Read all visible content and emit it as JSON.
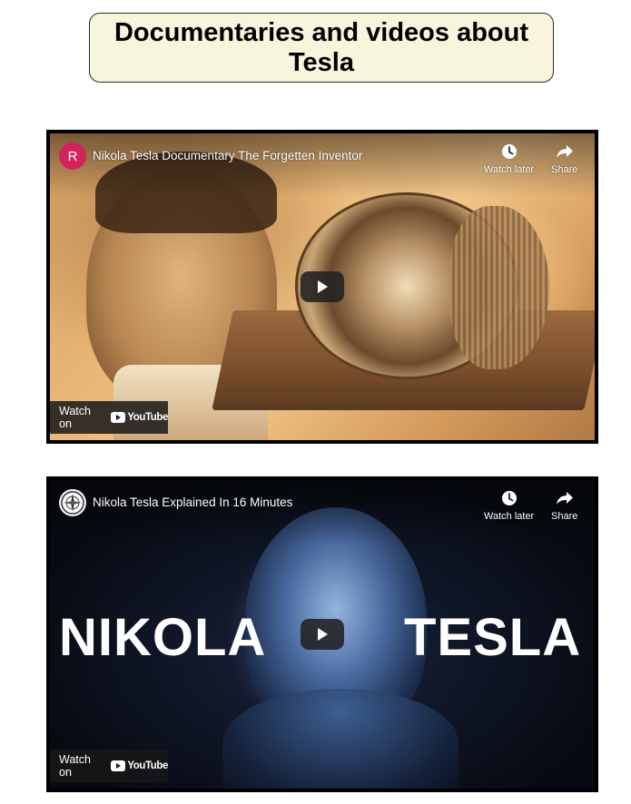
{
  "page": {
    "heading": "Documentaries and videos about Tesla"
  },
  "videos": [
    {
      "channel_initial": "R",
      "title": "Nikola Tesla Documentary The Forgetten Inventor",
      "watch_later_label": "Watch later",
      "share_label": "Share",
      "watch_on_label": "Watch on",
      "youtube_label": "YouTube",
      "avatar_color": "#d2245c"
    },
    {
      "channel_initial": "",
      "title": "Nikola Tesla Explained In 16 Minutes",
      "watch_later_label": "Watch later",
      "share_label": "Share",
      "watch_on_label": "Watch on",
      "youtube_label": "YouTube",
      "thumbnail_text_left": "NIKOLA",
      "thumbnail_text_right": "TESLA"
    }
  ],
  "colors": {
    "heading_box_bg": "#f7f5dc",
    "youtube_red": "#ff0000"
  }
}
